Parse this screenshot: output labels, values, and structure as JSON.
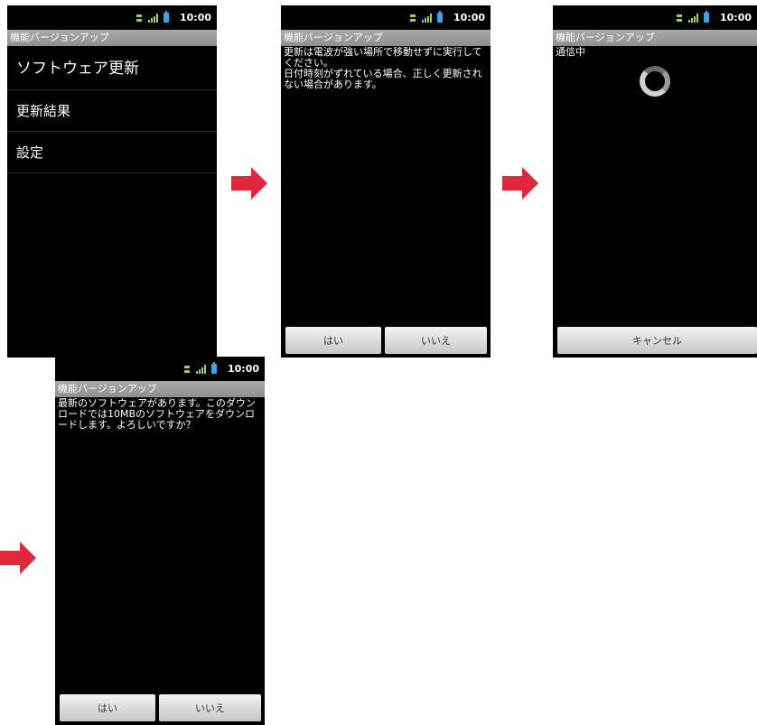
{
  "status": {
    "time": "10:00"
  },
  "app_title": "機能バージョンアップ",
  "screen1": {
    "menu": [
      "ソフトウェア更新",
      "更新結果",
      "設定"
    ]
  },
  "screen2": {
    "message": "更新は電波が強い場所で移動せずに実行してください。\n日付時刻がずれている場合、正しく更新されない場合があります。",
    "yes_label": "はい",
    "no_label": "いいえ"
  },
  "screen3": {
    "status_text": "通信中",
    "cancel_label": "キャンセル"
  },
  "screen4": {
    "message": "最新のソフトウェアがあります。このダウンロードでは10MBのソフトウェアをダウンロードします。よろしいですか？",
    "yes_label": "はい",
    "no_label": "いいえ"
  },
  "colors": {
    "arrow": "#e0283c",
    "screen_bg": "#000000",
    "titlebar": "#9e9e9e"
  }
}
